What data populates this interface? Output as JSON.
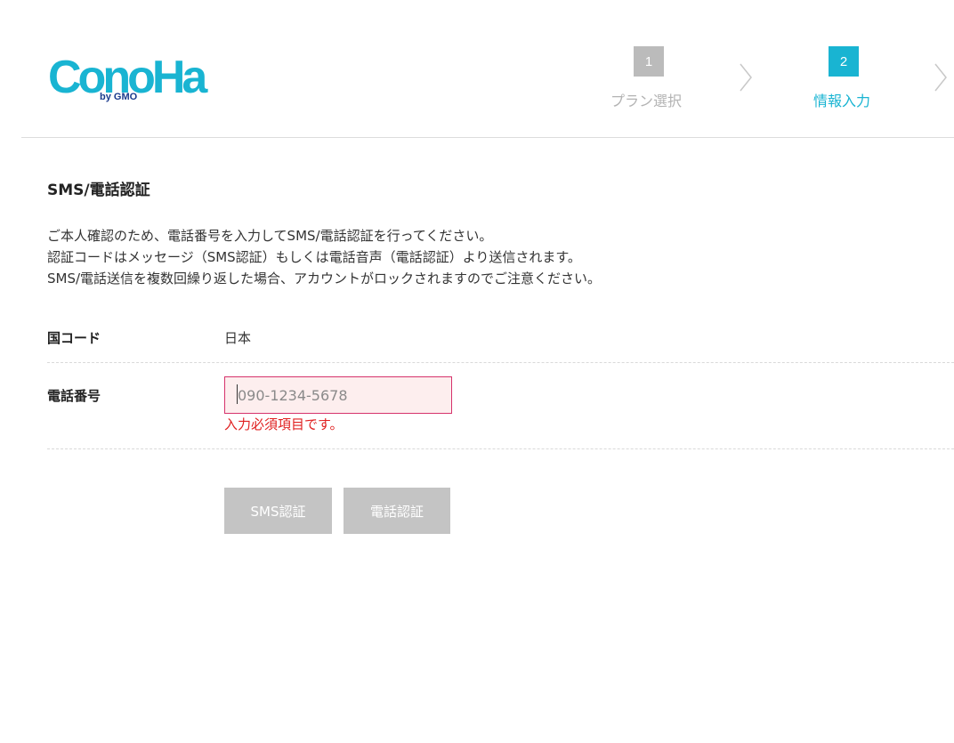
{
  "header": {
    "logo": {
      "text": "ConoHa",
      "sub": "by GMO",
      "color": "#19b4d2"
    },
    "steps": [
      {
        "number": "1",
        "label": "プラン選択",
        "state": "inactive"
      },
      {
        "number": "2",
        "label": "情報入力",
        "state": "active"
      }
    ],
    "chevron_icon": "chevron-right-icon"
  },
  "section": {
    "title": "SMS/電話認証",
    "description": [
      "ご本人確認のため、電話番号を入力してSMS/電話認証を行ってください。",
      "認証コードはメッセージ（SMS認証）もしくは電話音声（電話認証）より送信されます。",
      "SMS/電話送信を複数回繰り返した場合、アカウントがロックされますのでご注意ください。"
    ]
  },
  "form": {
    "country": {
      "label": "国コード",
      "value": "日本"
    },
    "phone": {
      "label": "電話番号",
      "value": "",
      "placeholder": "090-1234-5678",
      "error": "入力必須項目です。"
    }
  },
  "buttons": {
    "sms": "SMS認証",
    "voice": "電話認証"
  },
  "colors": {
    "accent": "#19b4d2",
    "error": "#e02020",
    "error_border": "#d6336c",
    "error_bg": "#fdeeee",
    "button_disabled": "#c4c4c4"
  }
}
